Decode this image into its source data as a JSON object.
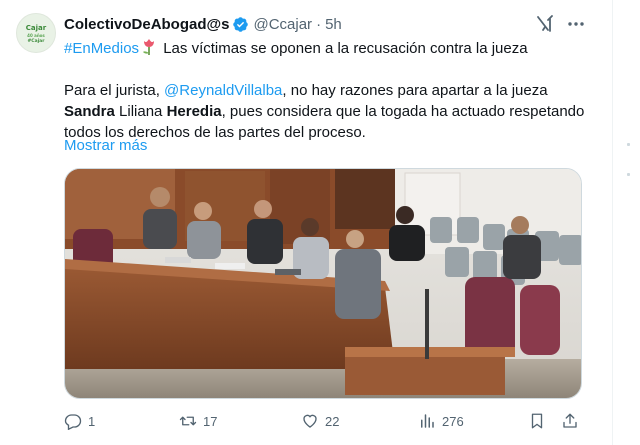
{
  "account": {
    "display_name": "ColectivoDeAbogad@s",
    "handle": "@Ccajar",
    "separator": "·",
    "time": "5h",
    "avatar_text_1": "Cajar",
    "avatar_text_2": "40 años",
    "avatar_text_3": "#Cajar"
  },
  "tweet": {
    "hashtag": "#EnMedios",
    "headline": " Las víctimas se oponen a la recusación contra la jueza",
    "para_prefix": "Para el jurista, ",
    "mention": "@ReynaldVillalba",
    "para_mid": ", no hay razones para apartar a la jueza ",
    "bold_first": "Sandra",
    "middle_name": " Liliana ",
    "bold_last": "Heredia",
    "para_rest": ", pues considera que la togada ha actuado respetando todos los derechos de las partes del proceso.",
    "show_more": "Mostrar más"
  },
  "actions": {
    "replies": "1",
    "retweets": "17",
    "likes": "22",
    "views": "276"
  },
  "colors": {
    "link": "#1d9bf0",
    "text": "#0f1419",
    "muted": "#536471",
    "verified": "#1d9bf0"
  },
  "icons": [
    "verified-badge-icon",
    "tulip-emoji-icon",
    "grok-icon",
    "more-icon",
    "reply-icon",
    "retweet-icon",
    "like-icon",
    "views-icon",
    "bookmark-icon",
    "share-icon"
  ]
}
